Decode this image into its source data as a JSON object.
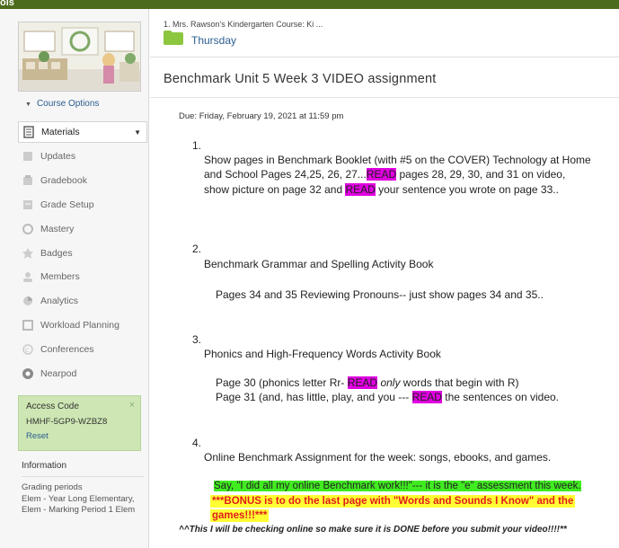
{
  "topbar": {
    "label": "ols"
  },
  "sidebar": {
    "course_options": "Course Options",
    "nav": [
      {
        "label": "Materials",
        "icon": "materials-icon",
        "active": true
      },
      {
        "label": "Updates",
        "icon": "updates-icon"
      },
      {
        "label": "Gradebook",
        "icon": "gradebook-icon"
      },
      {
        "label": "Grade Setup",
        "icon": "grade-setup-icon"
      },
      {
        "label": "Mastery",
        "icon": "mastery-icon"
      },
      {
        "label": "Badges",
        "icon": "badges-icon"
      },
      {
        "label": "Members",
        "icon": "members-icon"
      },
      {
        "label": "Analytics",
        "icon": "analytics-icon"
      },
      {
        "label": "Workload Planning",
        "icon": "workload-icon"
      },
      {
        "label": "Conferences",
        "icon": "conferences-icon"
      },
      {
        "label": "Nearpod",
        "icon": "nearpod-icon"
      }
    ],
    "access": {
      "title": "Access Code",
      "code": "HMHF-5GP9-WZBZ8",
      "reset": "Reset",
      "close": "×"
    },
    "info": {
      "title": "Information",
      "text": "Grading periods\nElem - Year Long Elementary, Elem - Marking Period 1 Elem"
    }
  },
  "main": {
    "breadcrumb": "1. Mrs. Rawson's Kindergarten Course: Ki ...",
    "folder": "Thursday",
    "title": "Benchmark Unit 5 Week 3 VIDEO assignment",
    "due": "Due: Friday, February 19, 2021 at 11:59 pm",
    "items": {
      "n1": "1.",
      "n2": "2.",
      "n3": "3.",
      "n4": "4.",
      "i1_l1": "Show pages in Benchmark Booklet (with #5 on the COVER) Technology at Home",
      "i1_l2a": "and School     Pages 24,25, 26, 27...",
      "i1_read1": "READ",
      "i1_l2b": " pages 28, 29, 30, and 31 on video,",
      "i1_l3a": "show picture on page 32  and ",
      "i1_read2": "READ",
      "i1_l3b": " your sentence you wrote on page 33..",
      "i2_l1": "Benchmark Grammar and Spelling Activity Book",
      "i2_l2": "Pages 34 and 35 Reviewing  Pronouns-- just show pages 34 and 35..",
      "i3_l1": "Phonics and High-Frequency Words Activity Book",
      "i3_l2a": "Page 30 (phonics letter Rr- ",
      "i3_read1": "READ",
      "i3_only": "only",
      "i3_l2b": " words that begin with R)",
      "i3_l3a": "Page 31  (and, has little, play, and you  --- ",
      "i3_read2": "READ",
      "i3_l3b": " the sentences on video.",
      "i4_l1": "Online Benchmark Assignment for the week:  songs, ebooks, and games.",
      "i4_say": "Say, \"I did all my online Benchmark work!!!\"--- it is the \"e\" assessment this week.",
      "i4_bonus1": "***BONUS is to do the last page with \"Words and Sounds I Know\" and the",
      "i4_bonus2": "games!!!***"
    },
    "final_note": "^^This I will be checking online so make sure it is DONE before you submit your video!!!!**"
  }
}
